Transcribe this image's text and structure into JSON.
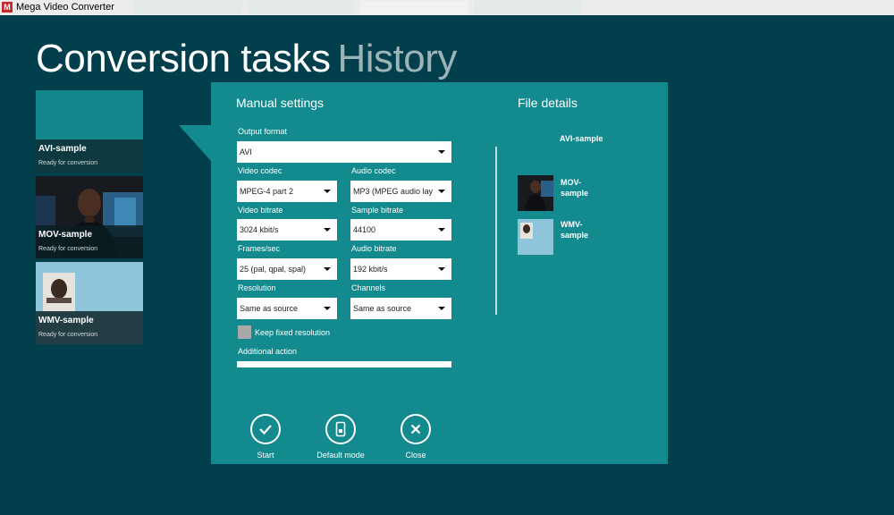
{
  "window": {
    "title": "Mega Video Converter",
    "logo_letter": "M"
  },
  "header": {
    "title": "Conversion tasks",
    "subtitle": "History"
  },
  "tasks": [
    {
      "name": "AVI-sample",
      "status": "Ready for conversion"
    },
    {
      "name": "MOV-sample",
      "status": "Ready for conversion"
    },
    {
      "name": "WMV-sample",
      "status": "Ready for conversion"
    }
  ],
  "manual": {
    "title": "Manual settings",
    "output_format": {
      "label": "Output format",
      "value": "AVI"
    },
    "video_codec": {
      "label": "Video codec",
      "value": "MPEG-4 part 2"
    },
    "audio_codec": {
      "label": "Audio codec",
      "value": "MP3 (MPEG audio lay"
    },
    "video_bitrate": {
      "label": "Video bitrate",
      "value": "3024 kbit/s"
    },
    "sample_bitrate": {
      "label": "Sample bitrate",
      "value": "44100"
    },
    "frames": {
      "label": "Frames/sec",
      "value": "25 (pal, qpal, spal)"
    },
    "audio_bitrate": {
      "label": "Audio bitrate",
      "value": "192 kbit/s"
    },
    "resolution": {
      "label": "Resolution",
      "value": "Same as source"
    },
    "channels": {
      "label": "Channels",
      "value": "Same as source"
    },
    "keep_fixed": {
      "label": "Keep fixed resolution",
      "checked": false
    },
    "additional_action": {
      "label": "Additional action",
      "value": ""
    }
  },
  "file_details": {
    "title": "File details",
    "current": "AVI-sample",
    "items": [
      {
        "name": "MOV-\nsample"
      },
      {
        "name": "WMV-\nsample"
      }
    ]
  },
  "actions": {
    "start": "Start",
    "default_mode": "Default mode",
    "close": "Close"
  },
  "colors": {
    "background": "#013f4d",
    "panel": "#138a8e",
    "tile_accent": "#12888c"
  }
}
